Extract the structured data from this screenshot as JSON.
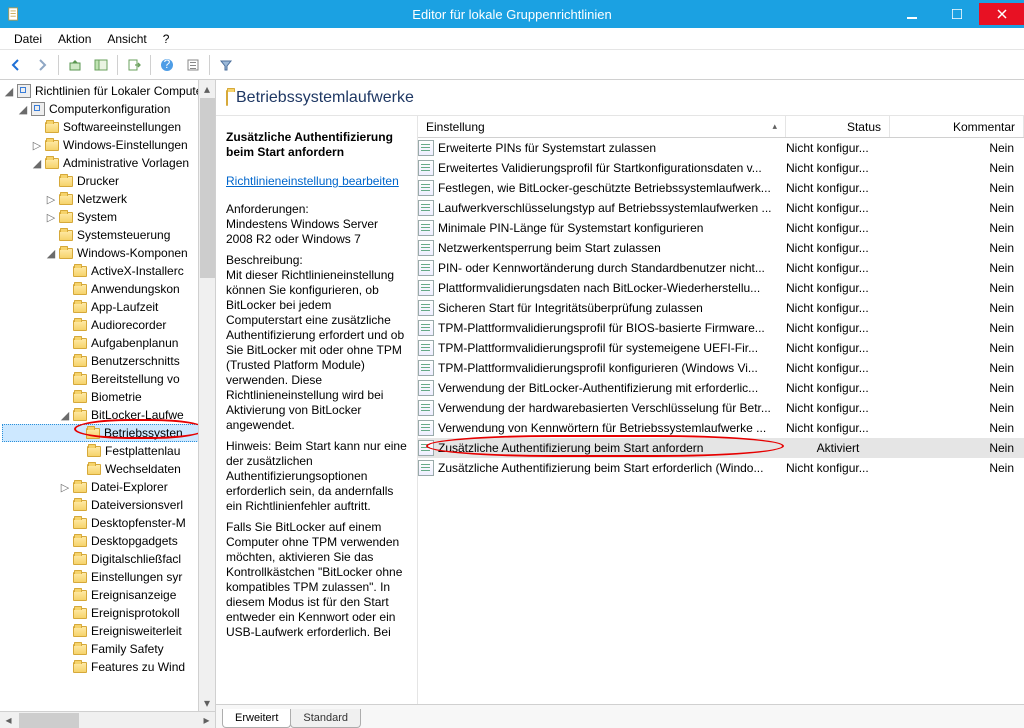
{
  "window": {
    "title": "Editor für lokale Gruppenrichtlinien"
  },
  "menu": {
    "datei": "Datei",
    "aktion": "Aktion",
    "ansicht": "Ansicht",
    "help": "?"
  },
  "tree": {
    "root": "Richtlinien für Lokaler Compute",
    "computerkonfig": "Computerkonfiguration",
    "software": "Softwareeinstellungen",
    "windows": "Windows-Einstellungen",
    "adminvorl": "Administrative Vorlagen",
    "drucker": "Drucker",
    "netzwerk": "Netzwerk",
    "system": "System",
    "systemsteuerung": "Systemsteuerung",
    "winkomp": "Windows-Komponen",
    "activex": "ActiveX-Installerc",
    "anwendungskon": "Anwendungskon",
    "applaufzeit": "App-Laufzeit",
    "audiorec": "Audiorecorder",
    "aufgaben": "Aufgabenplanun",
    "benutzerschn": "Benutzerschnitts",
    "bereitstellung": "Bereitstellung vo",
    "biometrie": "Biometrie",
    "bitlocker": "BitLocker-Laufwe",
    "betriebssystem": "Betriebssysten",
    "festplatten": "Festplattenlau",
    "wechseldat": "Wechseldaten",
    "dateiexp": "Datei-Explorer",
    "dateivers": "Dateiversionsverl",
    "desktopfm": "Desktopfenster-M",
    "desktopgadgets": "Desktopgadgets",
    "digitalschl": "Digitalschließfacl",
    "einstellungen": "Einstellungen syr",
    "ereignisanz": "Ereignisanzeige",
    "ereignisproto": "Ereignisprotokoll",
    "ereignisweit": "Ereignisweiterleit",
    "familysafety": "Family Safety",
    "features": "Features zu Wind"
  },
  "header": {
    "title": "Betriebssystemlaufwerke"
  },
  "desc": {
    "title": "Zusätzliche Authentifizierung beim Start anfordern",
    "editlink": "Richtlinieneinstellung bearbeiten",
    "req_label": "Anforderungen:",
    "req_text": "Mindestens Windows Server 2008 R2 oder Windows 7",
    "desc_label": "Beschreibung:",
    "desc_p1": "Mit dieser Richtlinieneinstellung können Sie konfigurieren, ob BitLocker bei jedem Computerstart eine zusätzliche Authentifizierung erfordert und ob Sie BitLocker mit oder ohne TPM (Trusted Platform Module) verwenden. Diese Richtlinieneinstellung wird bei Aktivierung von BitLocker angewendet.",
    "desc_p2": "Hinweis: Beim Start kann nur eine der zusätzlichen Authentifizierungsoptionen erforderlich sein, da andernfalls ein Richtlinienfehler auftritt.",
    "desc_p3": "Falls Sie BitLocker auf einem Computer ohne TPM verwenden möchten, aktivieren Sie das Kontrollkästchen \"BitLocker ohne kompatibles TPM zulassen\". In diesem Modus ist für den Start entweder ein Kennwort oder ein USB-Laufwerk erforderlich. Bei"
  },
  "cols": {
    "einstellung": "Einstellung",
    "status": "Status",
    "kommentar": "Kommentar"
  },
  "status": {
    "nk": "Nicht konfigur...",
    "aktiv": "Aktiviert",
    "nein": "Nein"
  },
  "rows": [
    {
      "name": "Erweiterte PINs für Systemstart zulassen",
      "status": "nk"
    },
    {
      "name": "Erweitertes Validierungsprofil für Startkonfigurationsdaten v...",
      "status": "nk"
    },
    {
      "name": "Festlegen, wie BitLocker-geschützte Betriebssystemlaufwerk...",
      "status": "nk"
    },
    {
      "name": "Laufwerkverschlüsselungstyp auf Betriebssystemlaufwerken ...",
      "status": "nk"
    },
    {
      "name": "Minimale PIN-Länge für Systemstart konfigurieren",
      "status": "nk"
    },
    {
      "name": "Netzwerkentsperrung beim Start zulassen",
      "status": "nk"
    },
    {
      "name": "PIN- oder Kennwortänderung durch Standardbenutzer nicht...",
      "status": "nk"
    },
    {
      "name": "Plattformvalidierungsdaten nach BitLocker-Wiederherstellu...",
      "status": "nk"
    },
    {
      "name": "Sicheren Start für Integritätsüberprüfung zulassen",
      "status": "nk"
    },
    {
      "name": "TPM-Plattformvalidierungsprofil für BIOS-basierte Firmware...",
      "status": "nk"
    },
    {
      "name": "TPM-Plattformvalidierungsprofil für systemeigene UEFI-Fir...",
      "status": "nk"
    },
    {
      "name": "TPM-Plattformvalidierungsprofil konfigurieren (Windows Vi...",
      "status": "nk"
    },
    {
      "name": "Verwendung der BitLocker-Authentifizierung mit erforderlic...",
      "status": "nk"
    },
    {
      "name": "Verwendung der hardwarebasierten Verschlüsselung für Betr...",
      "status": "nk"
    },
    {
      "name": "Verwendung von Kennwörtern für Betriebssystemlaufwerke ...",
      "status": "nk"
    },
    {
      "name": "Zusätzliche Authentifizierung beim Start anfordern",
      "status": "aktiv",
      "sel": true
    },
    {
      "name": "Zusätzliche Authentifizierung beim Start erforderlich (Windo...",
      "status": "nk"
    }
  ],
  "tabs": {
    "erweitert": "Erweitert",
    "standard": "Standard"
  }
}
